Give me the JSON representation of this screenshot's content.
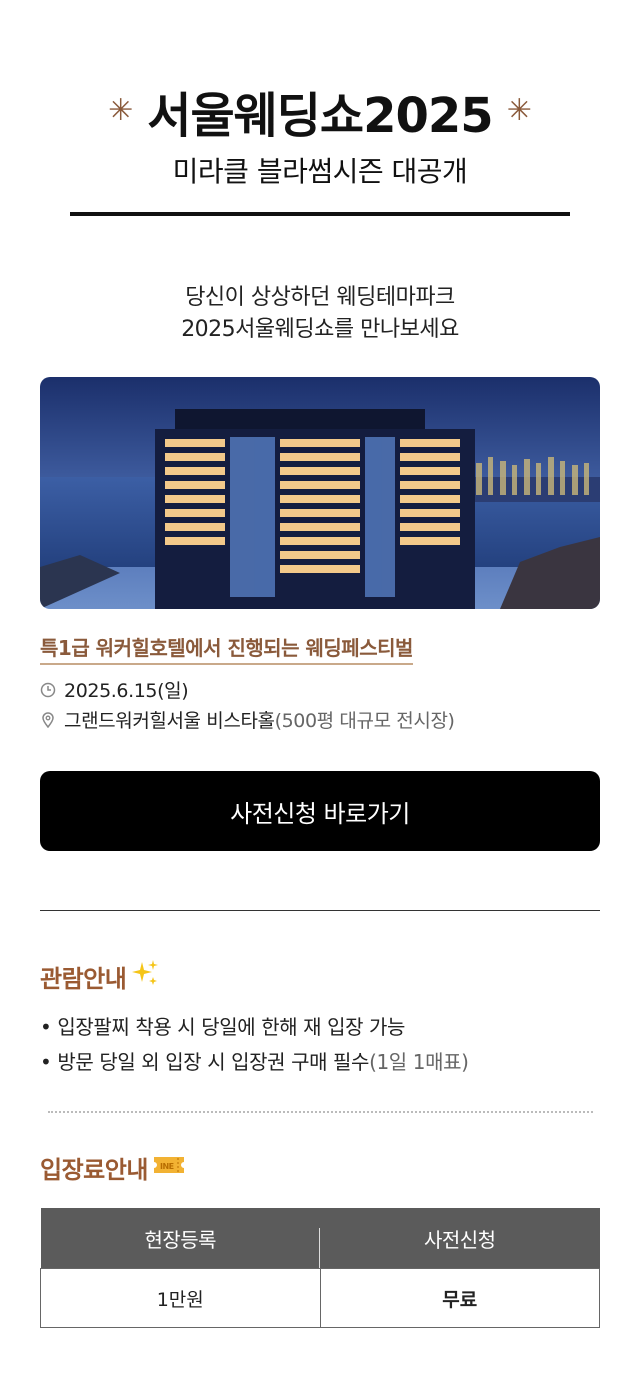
{
  "header": {
    "title": "서울웨딩쇼2025",
    "subtitle": "미라클 블라썸시즌 대공개",
    "star_left": "✳",
    "star_right": "✳"
  },
  "intro": {
    "line1": "당신이 상상하던 웨딩테마파크",
    "line2": "2025서울웨딩쇼를 만나보세요"
  },
  "event": {
    "tagline": "특1급 워커힐호텔에서 진행되는 웨딩페스티벌",
    "date": "2025.6.15(일)",
    "venue": "그랜드워커힐서울 비스타홀",
    "venue_detail": "(500평 대규모 전시장)",
    "date_icon": "clock-icon",
    "venue_icon": "location-pin-icon"
  },
  "cta": {
    "label": "사전신청 바로가기"
  },
  "viewing_info": {
    "title": "관람안내",
    "title_icon": "sparkles-icon",
    "items": [
      {
        "text": "입장팔찌 착용 시 당일에 한해 재 입장 가능",
        "note": ""
      },
      {
        "text": "방문 당일 외 입장 시 입장권 구매 필수",
        "note": "(1일 1매표)"
      }
    ]
  },
  "fee_info": {
    "title": "입장료안내",
    "title_icon": "ticket-icon",
    "columns": [
      "현장등록",
      "사전신청"
    ],
    "values": [
      "1만원",
      "무료"
    ]
  },
  "colors": {
    "accent_brown": "#9a5a32",
    "free_pink": "#e0177a",
    "table_header": "#5b5b5b"
  }
}
